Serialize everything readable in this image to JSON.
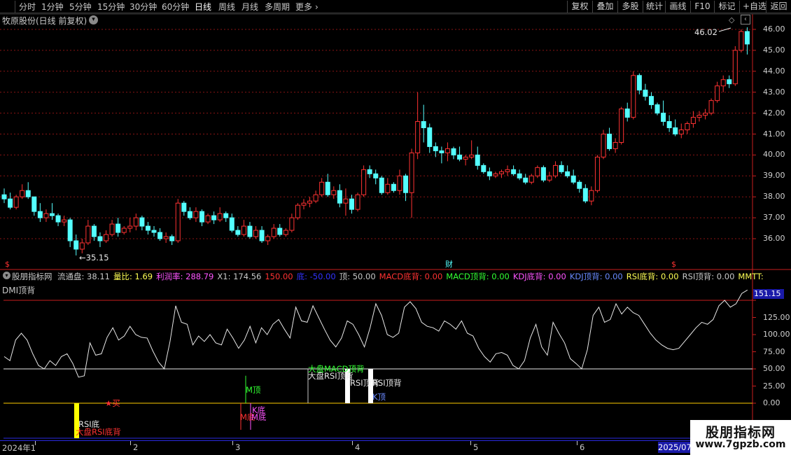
{
  "toolbar": {
    "periods": [
      "分时",
      "1分钟",
      "5分钟",
      "15分钟",
      "30分钟",
      "60分钟",
      "日线",
      "周线",
      "月线",
      "多周期",
      "更多"
    ],
    "active_period": "日线",
    "more_chevron_icon": "chevron-right-icon",
    "buttons": [
      "复权",
      "叠加",
      "多股",
      "统计",
      "画线",
      "F10",
      "+自选",
      "返回"
    ]
  },
  "stock": {
    "title": "牧原股份(日线 前复权)",
    "dropdown_icon": "chevron-down-circle-icon"
  },
  "price_chart": {
    "axis_ticks": [
      "46.00",
      "45.00",
      "44.00",
      "43.00",
      "42.00",
      "41.00",
      "40.00",
      "39.00",
      "38.00",
      "37.00",
      "36.00"
    ],
    "high_label": "46.02",
    "low_label": "35.15",
    "up_color": "#ff3232",
    "down_color": "#54ffff",
    "event_markers": [
      "$",
      "财",
      "$"
    ],
    "corner_icon": "diamond-icon"
  },
  "indicator": {
    "name": "股朋指标网",
    "legend": [
      {
        "label": "流通盘:",
        "value": "38.11",
        "color": "#c8c8c8"
      },
      {
        "label": "量比:",
        "value": "1.69",
        "color": "#ffff54"
      },
      {
        "label": "利润率:",
        "value": "288.79",
        "color": "#ff54ff"
      },
      {
        "label": "X1:",
        "value": "174.56",
        "color": "#c8c8c8"
      },
      {
        "label": "",
        "value": "150.00",
        "color": "#ff3232"
      },
      {
        "label": "底:",
        "value": "-50.00",
        "color": "#3232ff"
      },
      {
        "label": "顶:",
        "value": "50.00",
        "color": "#c8c8c8"
      },
      {
        "label": "MACD底背:",
        "value": "0.00",
        "color": "#ff3232"
      },
      {
        "label": "MACD顶背:",
        "value": "0.00",
        "color": "#32ff32"
      },
      {
        "label": "KDJ底背:",
        "value": "0.00",
        "color": "#ff54ff"
      },
      {
        "label": "KDJ顶背:",
        "value": "0.00",
        "color": "#6a8aff"
      },
      {
        "label": "RSI底背:",
        "value": "0.00",
        "color": "#ffff54"
      },
      {
        "label": "RSI顶背:",
        "value": "0.00",
        "color": "#c8c8c8"
      },
      {
        "label": "MMTT:",
        "value": "",
        "color": "#ffff54"
      }
    ],
    "dmi_label": "DMI顶背",
    "axis_ticks": [
      "150.00",
      "125.00",
      "100.00",
      "75.00",
      "50.00",
      "25.00",
      "0.00"
    ],
    "current_value": "151.15",
    "signals": {
      "rsi_bottom": "RSI底",
      "market_rsi_bottom_div": "大盘RSI底背",
      "buy": "买",
      "m_top": "M顶",
      "m_bottom": "M底",
      "m_bottom_2": "M底",
      "k_bottom": "K底",
      "market_macd_top_div": "大盘MACD顶背",
      "market_rsi_top_div": "大盘RSI顶背",
      "rsi_top_div_1": "RSI顶背",
      "rsi_top_div_2": "RSI顶背",
      "k_top": "K顶"
    }
  },
  "date_axis": {
    "labels": [
      "2024年1",
      "2",
      "3",
      "4",
      "5",
      "6"
    ],
    "end_label": "2025/07"
  },
  "watermark": {
    "title": "股朋指标网",
    "url": "www.7gpzb.com"
  }
}
